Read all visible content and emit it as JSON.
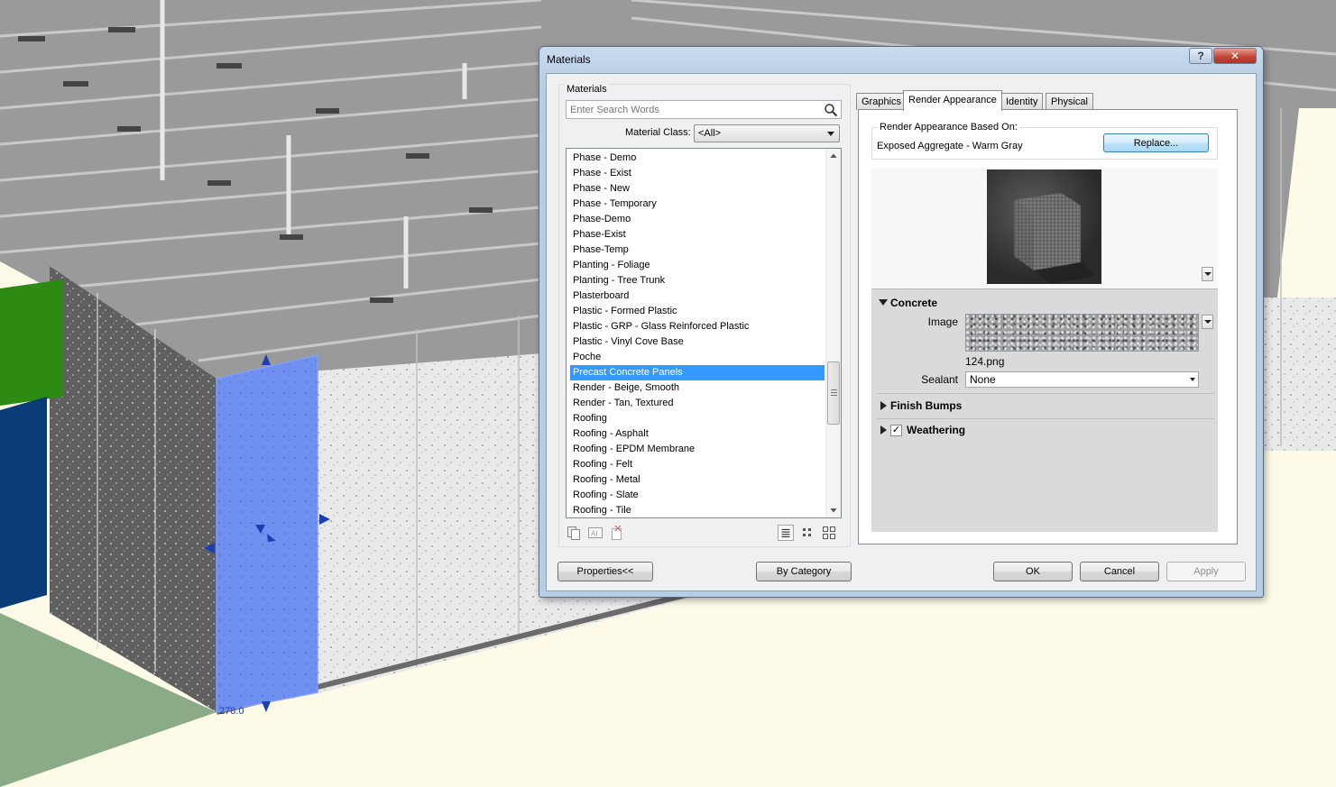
{
  "dialog": {
    "title": "Materials",
    "help_label": "?",
    "close_label": "✕"
  },
  "materials_panel": {
    "group_label": "Materials",
    "search_placeholder": "Enter Search Words",
    "class_label": "Material Class:",
    "class_value": "<All>",
    "items": [
      "Phase - Demo",
      "Phase - Exist",
      "Phase - New",
      "Phase - Temporary",
      "Phase-Demo",
      "Phase-Exist",
      "Phase-Temp",
      "Planting - Foliage",
      "Planting - Tree Trunk",
      "Plasterboard",
      "Plastic - Formed Plastic",
      "Plastic - GRP - Glass Reinforced Plastic",
      "Plastic - Vinyl Cove Base",
      "Poche",
      "Precast Concrete Panels",
      "Render - Beige, Smooth",
      "Render - Tan, Textured",
      "Roofing",
      "Roofing - Asphalt",
      "Roofing - EPDM Membrane",
      "Roofing - Felt",
      "Roofing - Metal",
      "Roofing - Slate",
      "Roofing - Tile"
    ],
    "selected_item": "Precast Concrete Panels",
    "tool_icons": [
      "duplicate-icon",
      "rename-icon",
      "delete-icon",
      "list-view-icon",
      "small-icons-view-icon",
      "large-icons-view-icon"
    ]
  },
  "tabs": [
    "Graphics",
    "Render Appearance",
    "Identity",
    "Physical"
  ],
  "active_tab": "Render Appearance",
  "render_appearance": {
    "based_on_label": "Render Appearance Based On:",
    "based_on_value": "Exposed Aggregate - Warm Gray",
    "replace_label": "Replace...",
    "sections": {
      "concrete": {
        "title": "Concrete",
        "expanded": true,
        "image_label": "Image",
        "image_file": "124.png",
        "sealant_label": "Sealant",
        "sealant_value": "None"
      },
      "finish_bumps": {
        "title": "Finish Bumps",
        "expanded": false
      },
      "weathering": {
        "title": "Weathering",
        "expanded": false,
        "checked": true,
        "check_mark": "✓"
      }
    }
  },
  "buttons": {
    "properties": "Properties<<",
    "by_category": "By Category",
    "ok": "OK",
    "cancel": "Cancel",
    "apply": "Apply"
  },
  "viewport": {
    "dimension_label": "278.0"
  },
  "colors": {
    "selection": "#3399ff",
    "title_gradient": "#b7cde4",
    "close_button": "#c2463a",
    "panel_highlight": "#5c86f0"
  }
}
